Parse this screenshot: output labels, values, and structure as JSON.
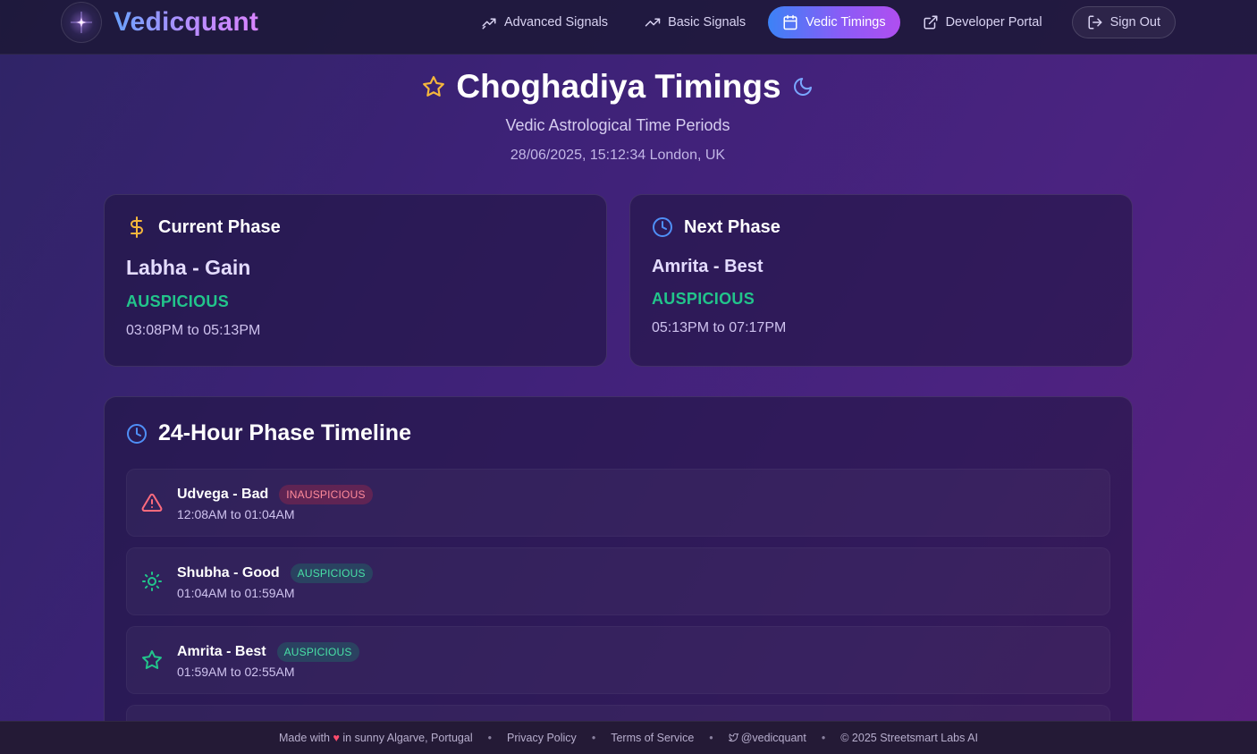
{
  "brand": {
    "name": "Vedicquant"
  },
  "nav": {
    "advanced_signals": "Advanced Signals",
    "basic_signals": "Basic Signals",
    "vedic_timings": "Vedic Timings",
    "developer_portal": "Developer Portal",
    "sign_out": "Sign Out"
  },
  "page": {
    "title": "Choghadiya Timings",
    "subtitle": "Vedic Astrological Time Periods",
    "datetime": "28/06/2025, 15:12:34 London, UK"
  },
  "current_phase": {
    "heading": "Current Phase",
    "name": "Labha - Gain",
    "status": "AUSPICIOUS",
    "time": "03:08PM to 05:13PM"
  },
  "next_phase": {
    "heading": "Next Phase",
    "name": "Amrita - Best",
    "status": "AUSPICIOUS",
    "time": "05:13PM to 07:17PM"
  },
  "timeline": {
    "heading": "24-Hour Phase Timeline",
    "items": [
      {
        "name": "Udvega - Bad",
        "badge": "INAUSPICIOUS",
        "time": "12:08AM to 01:04AM",
        "icon": "warning-icon"
      },
      {
        "name": "Shubha - Good",
        "badge": "AUSPICIOUS",
        "time": "01:04AM to 01:59AM",
        "icon": "sun-icon"
      },
      {
        "name": "Amrita - Best",
        "badge": "AUSPICIOUS",
        "time": "01:59AM to 02:55AM",
        "icon": "star-icon"
      }
    ]
  },
  "footer": {
    "made_with": "Made with",
    "heart": "♥",
    "location": "in sunny Algarve, Portugal",
    "privacy": "Privacy Policy",
    "terms": "Terms of Service",
    "twitter": "@vedicquant",
    "copyright": "© 2025 Streetsmart Labs AI"
  },
  "colors": {
    "auspicious": "#22c58b",
    "inauspicious": "#ff6b7d",
    "accent_blue": "#3c82f6",
    "accent_purple": "#8a5cf6",
    "gold": "#f6b73c"
  }
}
